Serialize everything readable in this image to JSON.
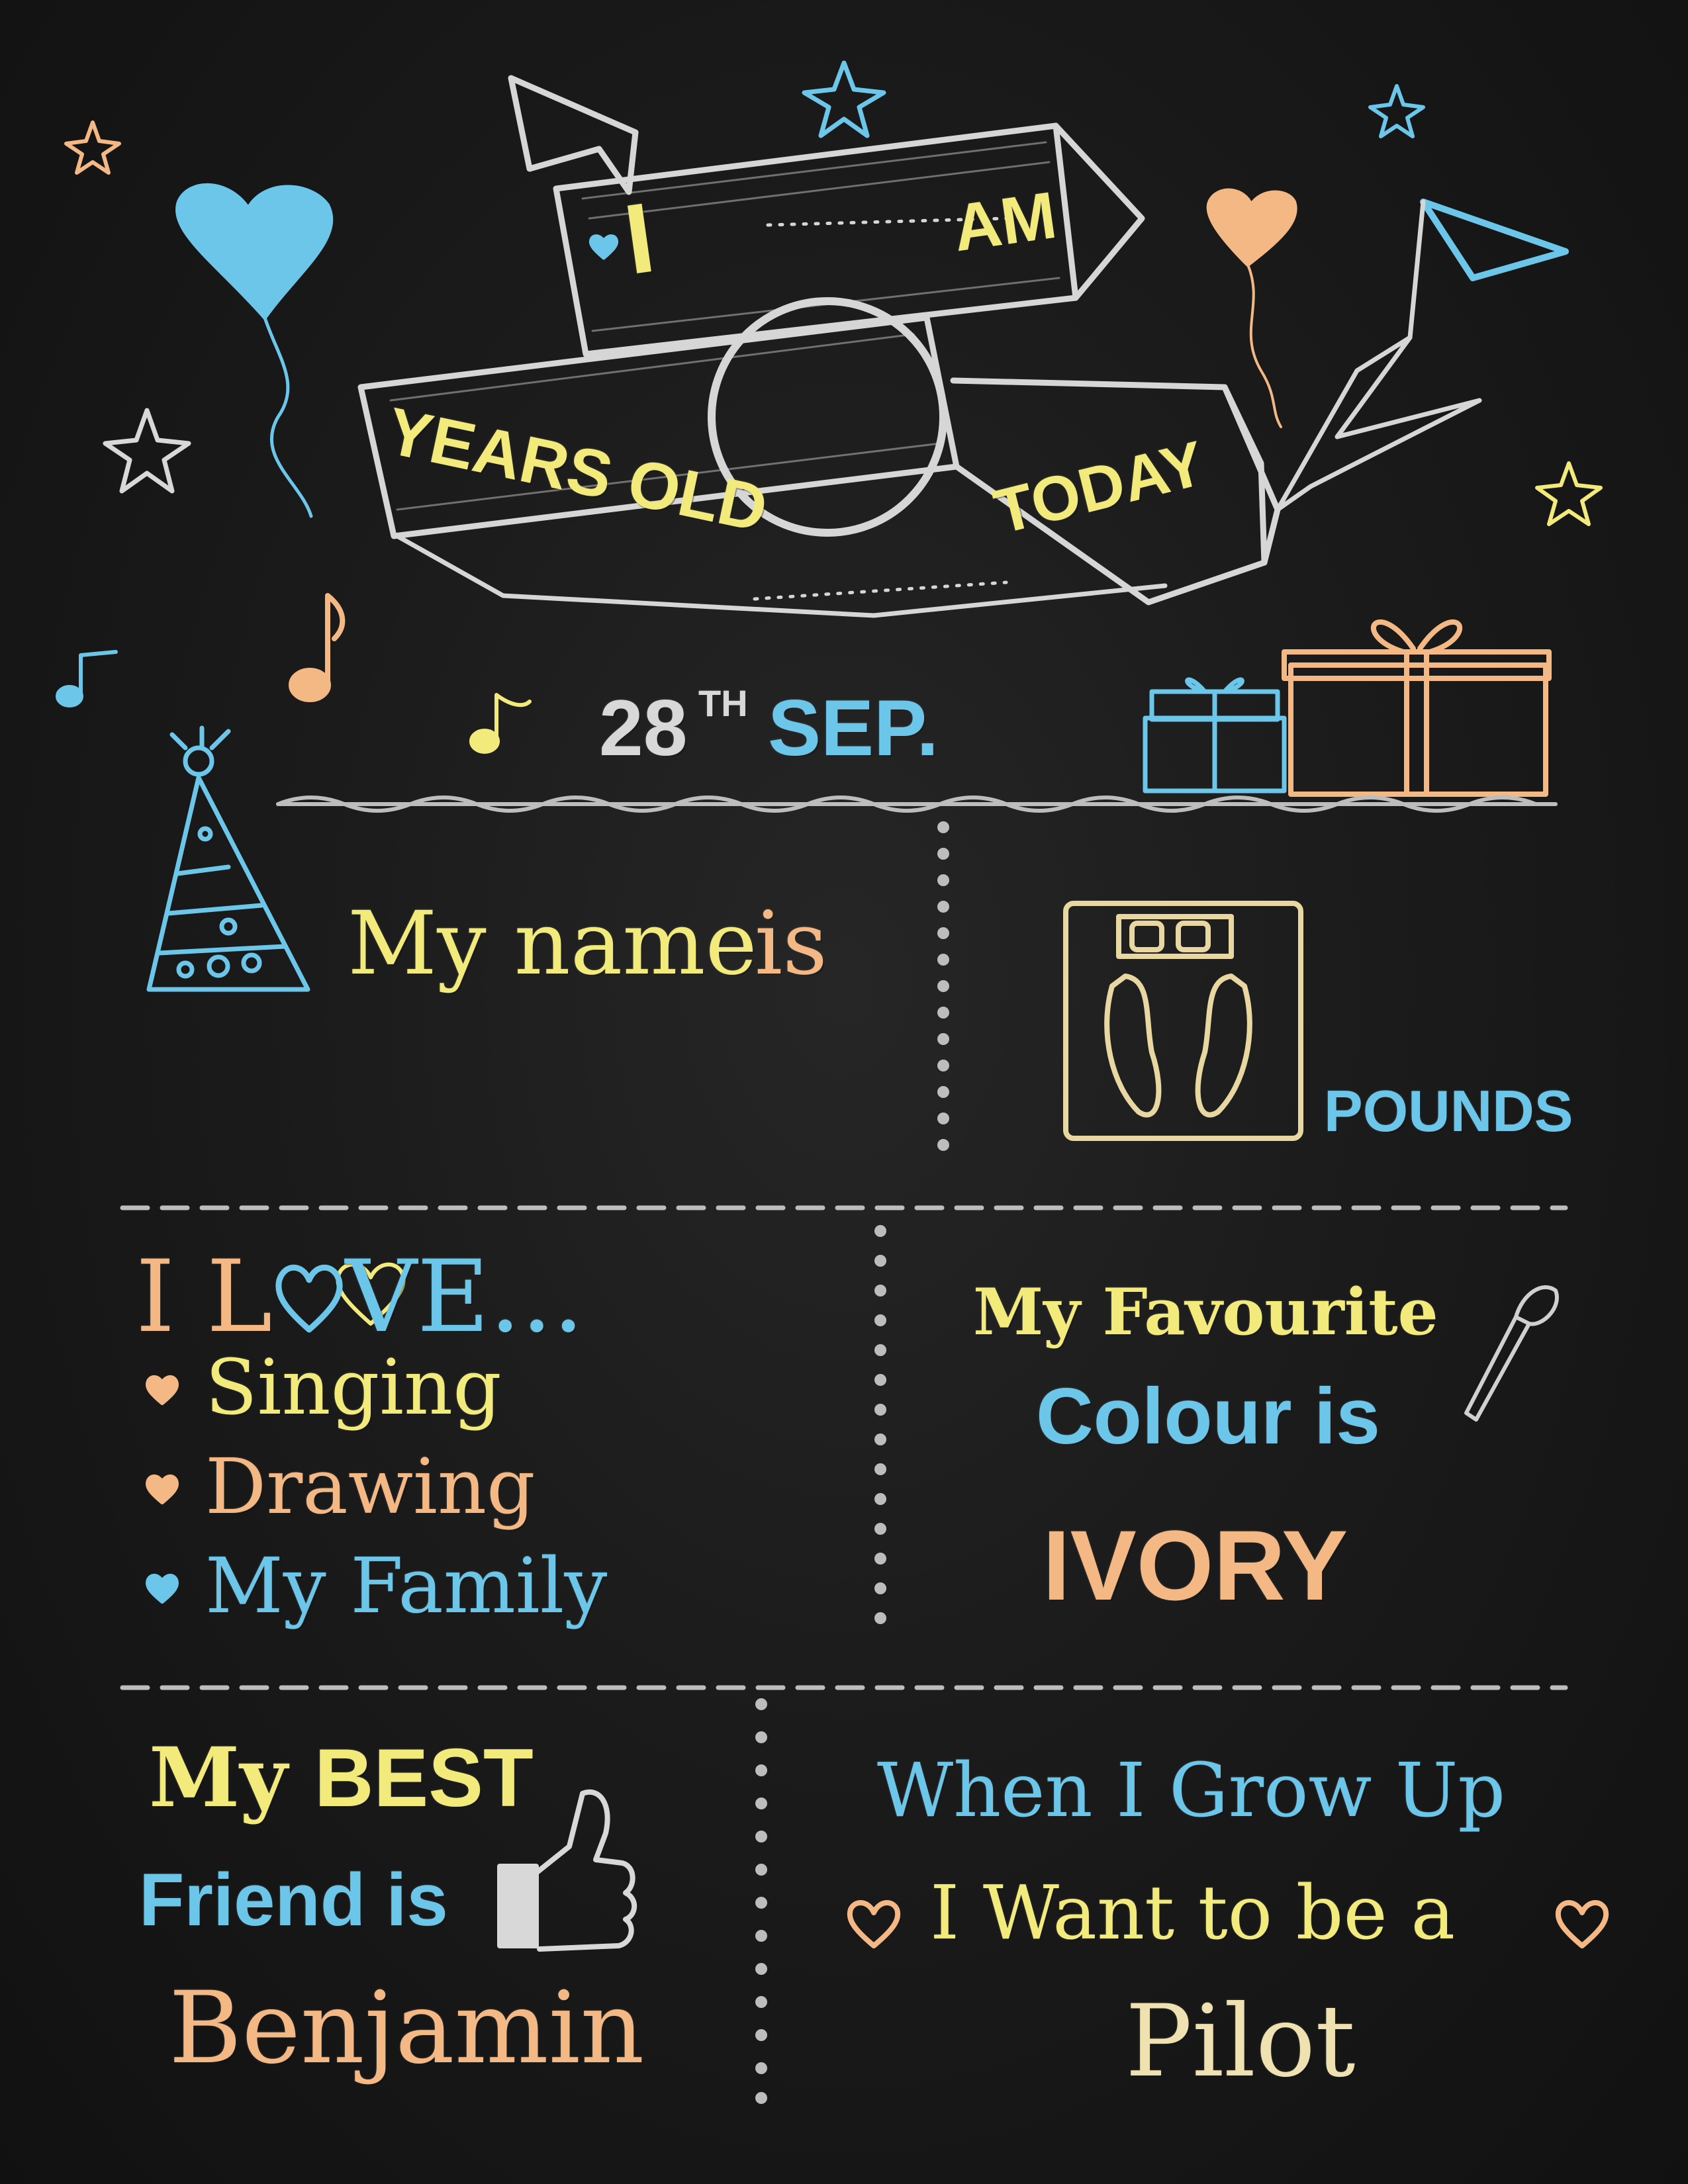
{
  "banner": {
    "i": "I",
    "am": "AM",
    "years_old": "YEARS OLD",
    "today": "TODAY"
  },
  "date": {
    "day": "28",
    "suffix": "TH",
    "month": "SEP."
  },
  "name": {
    "my_name": "My name",
    "is": "is"
  },
  "weight": {
    "unit": "POUNDS"
  },
  "love": {
    "prefix": "I L",
    "suffix": "VE...",
    "items": [
      "Singing",
      "Drawing",
      "My Family"
    ]
  },
  "colour": {
    "line1": "My Favourite",
    "line2": "Colour is",
    "value": "IVORY"
  },
  "friend": {
    "my": "My",
    "best": "BEST",
    "line2": "Friend is",
    "value": "Benjamin"
  },
  "grow": {
    "line1": "When I Grow Up",
    "line2": "I Want to be a",
    "value": "Pilot"
  },
  "colors": {
    "background": "#1b1b1b",
    "yellow": "#f2ea7a",
    "blue": "#6cc6ea",
    "peach": "#f4b885",
    "white": "#d8d8d8"
  }
}
